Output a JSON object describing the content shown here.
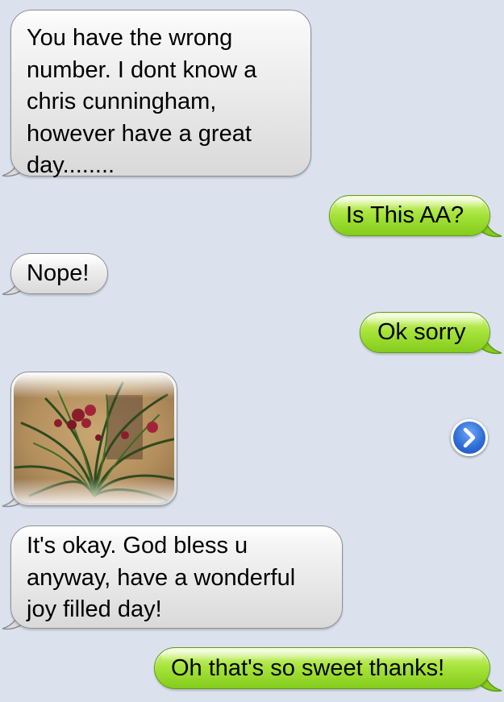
{
  "conversation": {
    "messages": [
      {
        "direction": "received",
        "type": "text",
        "text": "You have the wrong\nnumber.  I dont know a\nchris cunningham,\nhowever have a great\nday........"
      },
      {
        "direction": "sent",
        "type": "text",
        "text": "Is This AA?"
      },
      {
        "direction": "received",
        "type": "text",
        "text": "Nope!"
      },
      {
        "direction": "sent",
        "type": "text",
        "text": "Ok sorry"
      },
      {
        "direction": "received",
        "type": "image",
        "image_subject": "flowers-photo",
        "action_icon": "blue-disclosure-arrow-icon"
      },
      {
        "direction": "received",
        "type": "text",
        "text": "It's okay.  God bless u\nanyway, have a wonderful\njoy filled day!"
      },
      {
        "direction": "sent",
        "type": "text",
        "text": "Oh that's so sweet thanks!"
      }
    ]
  },
  "colors": {
    "background": "#dbe2ed",
    "received_bubble": "#e6e6e6",
    "sent_bubble": "#a6e33a",
    "disclosure_button": "#2f6fd8"
  }
}
